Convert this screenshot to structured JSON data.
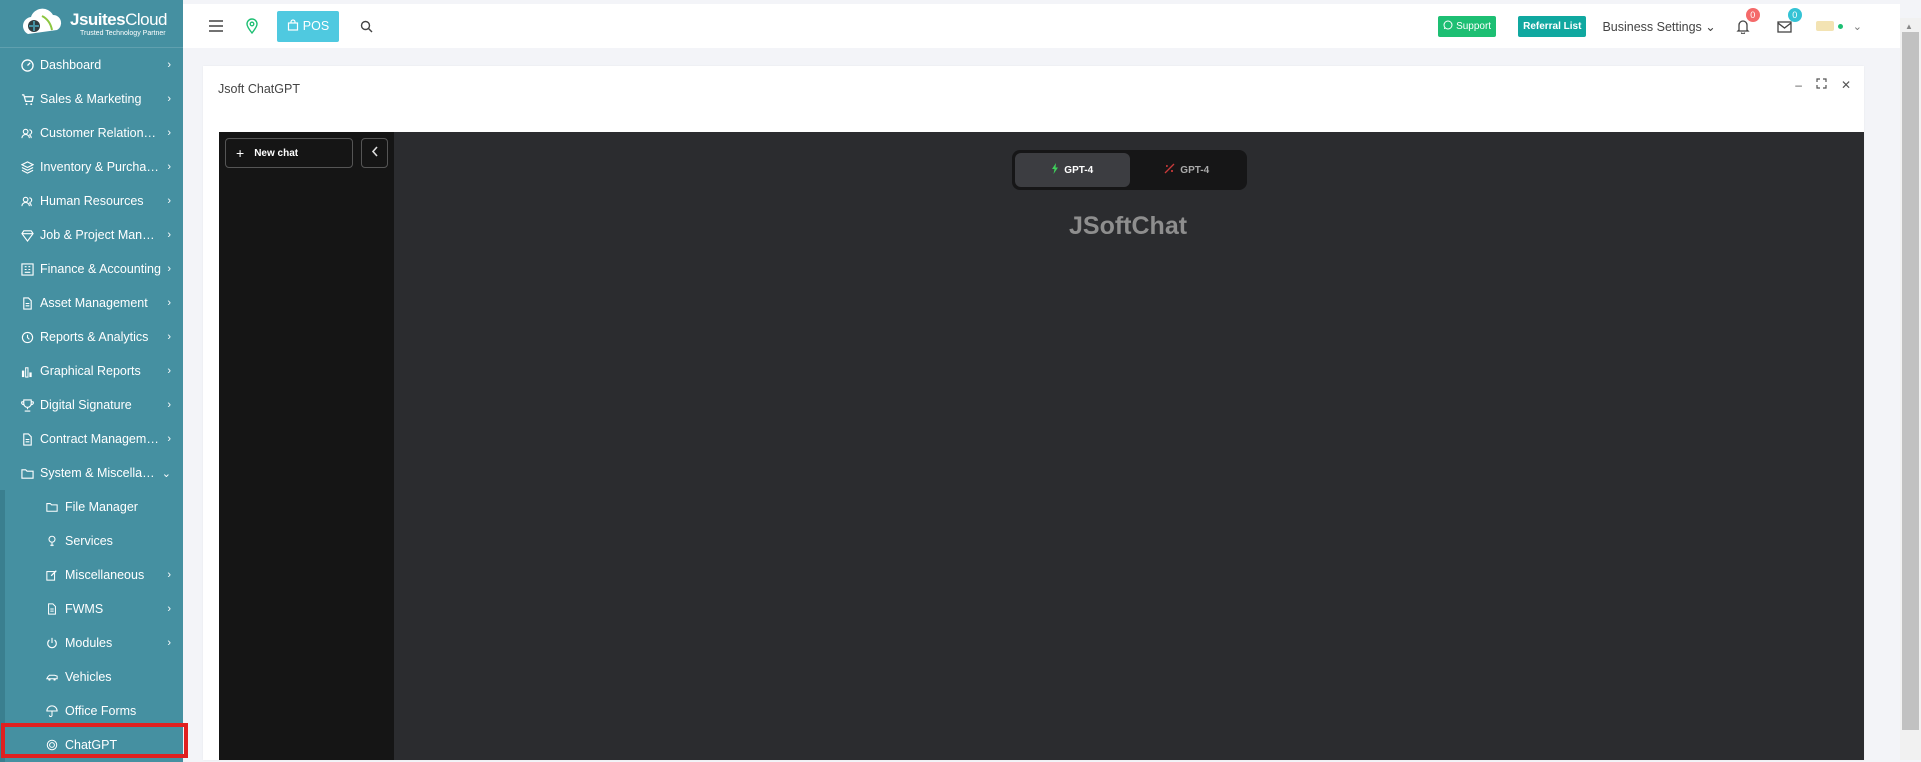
{
  "brand": {
    "name_bold": "Jsuites",
    "name_light": "Cloud",
    "tagline": "Trusted Technology Partner"
  },
  "topbar": {
    "pos_label": "POS",
    "support_label": "Support",
    "referral_label": "Referral List",
    "business_settings_label": "Business Settings",
    "notifications_count": "0",
    "messages_count": "0"
  },
  "sidebar": {
    "items": [
      {
        "label": "Dashboard",
        "icon": "gauge-icon"
      },
      {
        "label": "Sales & Marketing",
        "icon": "cart-icon"
      },
      {
        "label": "Customer Relationshi...",
        "icon": "users-icon"
      },
      {
        "label": "Inventory & Purchasi...",
        "icon": "layers-icon"
      },
      {
        "label": "Human Resources",
        "icon": "users-icon"
      },
      {
        "label": "Job & Project Manag...",
        "icon": "diamond-icon"
      },
      {
        "label": "Finance & Accounting",
        "icon": "ledger-icon"
      },
      {
        "label": "Asset Management",
        "icon": "document-icon"
      },
      {
        "label": "Reports & Analytics",
        "icon": "clock-icon"
      },
      {
        "label": "Graphical Reports",
        "icon": "bar-chart-icon"
      },
      {
        "label": "Digital Signature",
        "icon": "trophy-icon"
      },
      {
        "label": "Contract Management",
        "icon": "document-icon"
      },
      {
        "label": "System & Miscellaneo...",
        "icon": "folder-icon"
      }
    ],
    "sub_items": [
      {
        "label": "File Manager",
        "icon": "folder-icon"
      },
      {
        "label": "Services",
        "icon": "bulb-icon"
      },
      {
        "label": "Miscellaneous",
        "icon": "edit-icon"
      },
      {
        "label": "FWMS",
        "icon": "document-icon"
      },
      {
        "label": "Modules",
        "icon": "power-icon"
      },
      {
        "label": "Vehicles",
        "icon": "vehicle-icon"
      },
      {
        "label": "Office Forms",
        "icon": "umbrella-icon"
      },
      {
        "label": "ChatGPT",
        "icon": "target-icon"
      }
    ]
  },
  "panel": {
    "title": "Jsoft ChatGPT"
  },
  "chat": {
    "new_chat_label": "New chat",
    "models": [
      {
        "label": "GPT-4",
        "active": true
      },
      {
        "label": "GPT-4",
        "active": false
      }
    ],
    "title": "JSoftChat"
  },
  "colors": {
    "sidebar": "#4590a1",
    "accent": "#4fc9e0",
    "highlight": "#e02020",
    "chat_bg": "#2b2c2f"
  }
}
